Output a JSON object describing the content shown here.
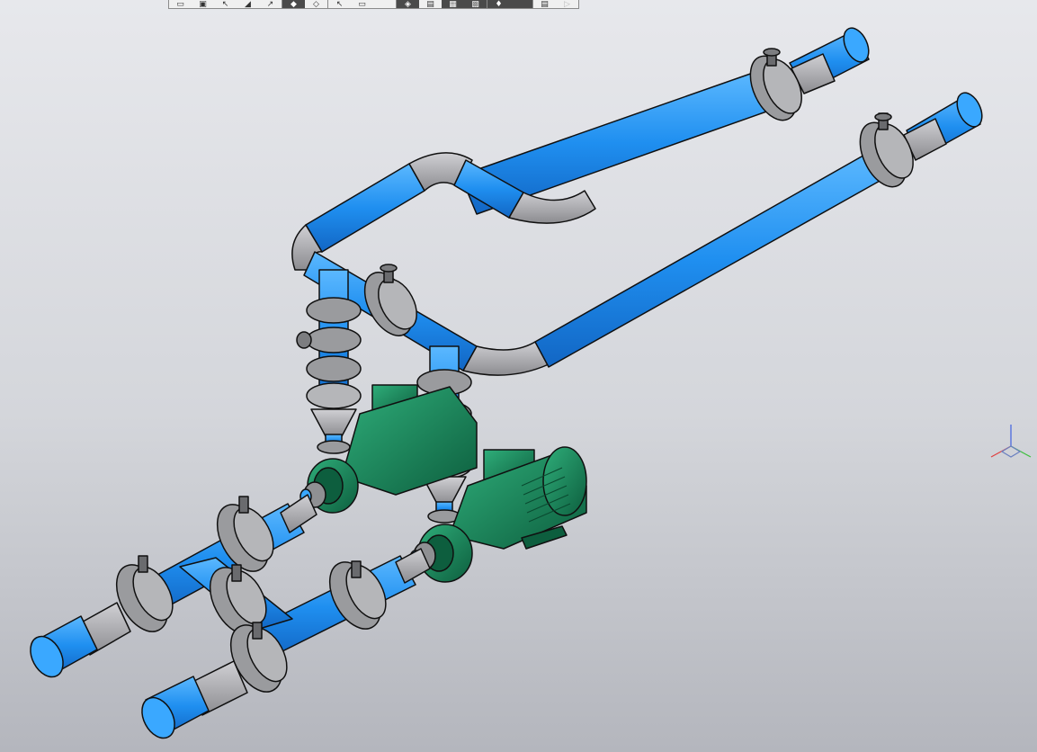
{
  "viewport": {
    "background_top": "#e7e8ec",
    "background_bottom": "#b4b6bd"
  },
  "colors": {
    "pipe_blue": "#1f8ff0",
    "pipe_blue_light": "#3aa8ff",
    "fitting_gray": "#a8a8ac",
    "flange_gray": "#8f9093",
    "pump_green": "#1a8a5e",
    "pump_green_dark": "#0f6a46",
    "outline": "#101010"
  },
  "toolbar": {
    "groups": [
      {
        "name": "view-tools",
        "buttons": [
          {
            "icon": "box-select-icon",
            "glyph": "▭",
            "active": false
          },
          {
            "icon": "box-zoom-icon",
            "glyph": "▣",
            "active": false
          },
          {
            "icon": "pan-icon",
            "glyph": "↖",
            "active": false
          },
          {
            "icon": "rotate-icon",
            "glyph": "◢",
            "active": false
          },
          {
            "icon": "measure-icon",
            "glyph": "↗",
            "active": false
          }
        ]
      },
      {
        "name": "display-mode",
        "buttons": [
          {
            "icon": "shaded-solid-icon",
            "glyph": "◆",
            "active": true
          },
          {
            "icon": "wireframe-cube-icon",
            "glyph": "◇",
            "active": false
          }
        ]
      },
      {
        "name": "select-tools",
        "buttons": [
          {
            "icon": "cursor-icon",
            "glyph": "↖",
            "active": false
          },
          {
            "icon": "select-frame-icon",
            "glyph": "▭",
            "active": false
          },
          {
            "icon": "blank-icon",
            "glyph": "",
            "active": false
          }
        ]
      },
      {
        "name": "section-tools",
        "buttons": [
          {
            "icon": "section-nodes-icon",
            "glyph": "◈",
            "active": true
          },
          {
            "icon": "section-plane-icon",
            "glyph": "▤",
            "active": false
          },
          {
            "icon": "section-view-icon",
            "glyph": "▦",
            "active": true
          },
          {
            "icon": "section-edit-icon",
            "glyph": "▧",
            "active": true
          }
        ]
      },
      {
        "name": "light-tools",
        "buttons": [
          {
            "icon": "light-icon",
            "glyph": "♦",
            "active": true
          },
          {
            "icon": "light-off-icon",
            "glyph": "",
            "active": true
          }
        ]
      },
      {
        "name": "extra-tools",
        "buttons": [
          {
            "icon": "properties-icon",
            "glyph": "▤",
            "active": false
          },
          {
            "icon": "play-icon",
            "glyph": "▷",
            "active": false,
            "disabled": true
          }
        ]
      }
    ]
  },
  "axis_triad": {
    "x_color": "#e04040",
    "y_color": "#40c040",
    "z_color": "#4060e0"
  },
  "model": {
    "parts": [
      "supply-pipe-upper",
      "supply-pipe-lower",
      "bypass-loop",
      "pump-left",
      "pump-right",
      "inlet-manifold-left",
      "inlet-manifold-right",
      "butterfly-valve"
    ]
  }
}
